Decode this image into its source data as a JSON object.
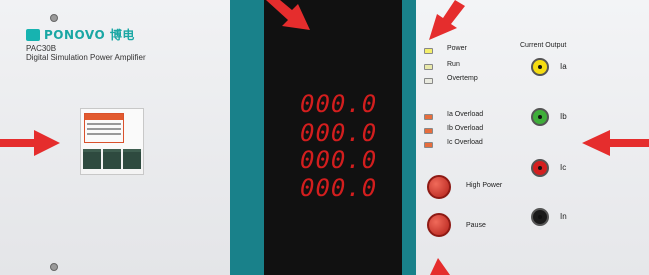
{
  "brand": {
    "logo_text": "PONOVO 博电",
    "model": "PAC30B",
    "description": "Digital Simulation Power Amplifier"
  },
  "display": {
    "readings": [
      "000.0",
      "000.0",
      "000.0",
      "000.0"
    ]
  },
  "status_indicators": [
    {
      "label": "Power",
      "color": "#f4ef6b"
    },
    {
      "label": "Run",
      "color": "#e9e9aa"
    },
    {
      "label": "Overtemp",
      "color": "#e9eadf"
    },
    {
      "label": "Ia Overload",
      "color": "#e76d3d"
    },
    {
      "label": "Ib Overload",
      "color": "#e76d3d"
    },
    {
      "label": "Ic Overload",
      "color": "#e76d3d"
    }
  ],
  "buttons": {
    "high_power": "High Power",
    "pause": "Pause"
  },
  "current_output": {
    "title": "Current Output",
    "jacks": [
      {
        "label": "Ia",
        "color": "#f5dc12"
      },
      {
        "label": "Ib",
        "color": "#3fae3a"
      },
      {
        "label": "Ic",
        "color": "#d31f1f"
      },
      {
        "label": "In",
        "color": "#1a1a1a"
      }
    ]
  },
  "colors": {
    "teal": "#19818a",
    "arrow": "#e52d2d",
    "digits": "#d31e1e"
  }
}
